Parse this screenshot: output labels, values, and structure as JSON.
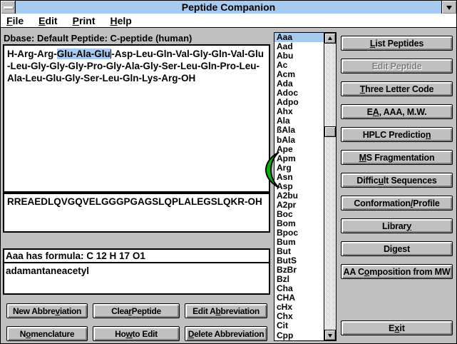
{
  "colors": {
    "title_bar_blue": "#A6CAF0",
    "window_gray": "#C0C0C0",
    "selection_highlight": "#A6CAF0",
    "marker_green": "#00B400"
  },
  "title_bar": {
    "title": "Peptide Companion"
  },
  "menu_bar": {
    "items": [
      {
        "label": "File",
        "u": 0
      },
      {
        "label": "Edit",
        "u": 0
      },
      {
        "label": "Print",
        "u": 0
      },
      {
        "label": "Help",
        "u": 0
      }
    ]
  },
  "status_line": {
    "text": "Dbase: Default  Peptide: C-peptide (human)"
  },
  "peptide_editor": {
    "pre_selection": "H-Arg-Arg-",
    "selection": "Glu-Ala-Glu",
    "post_selection": "-Asp-Leu-Gln-Val-Gly-Gln-Val-Glu-Leu-Gly-Gly-Gly-Pro-Gly-Ala-Gly-Ser-Leu-Gln-Pro-Leu-Ala-Leu-Glu-Gly-Ser-Leu-Gln-Lys-Arg-OH"
  },
  "one_letter_box": {
    "sequence": "RREAEDLQVGQVELGGGPGAGSLQPLALEGSLQKR-OH"
  },
  "abbreviation_info": {
    "formula_line": "Aaa  has formula:  C 12 H 17 O1",
    "full_name": "adamantaneacetyl"
  },
  "aa_list": {
    "selected_index": 0,
    "items": [
      "Aaa",
      "Aad",
      "Abu",
      "Ac",
      "Acm",
      "Ada",
      "Adoc",
      "Adpo",
      "Ahx",
      "Ala",
      "ßAla",
      "bAla",
      "Ape",
      "Apm",
      "Arg",
      "Asn",
      "Asp",
      "A2bu",
      "A2pr",
      "Boc",
      "Bom",
      "Bpoc",
      "Bum",
      "But",
      "ButS",
      "BzBr",
      "Bzl",
      "Cha",
      "CHA",
      "cHx",
      "Chx",
      "Cit",
      "Cpp"
    ]
  },
  "abbrev_buttons": {
    "new_abbreviation": {
      "label": "New Abbreviation",
      "u": 9
    },
    "clear_peptide": {
      "label": "Clear Peptide",
      "u": 4
    },
    "edit_abbreviation": {
      "label": "Edit Abbreviation",
      "u": 6
    },
    "nomenclature": {
      "label": "Nomenclature",
      "u": 1
    },
    "how_to_edit": {
      "label": "How to Edit",
      "u": 2
    },
    "delete_abbreviation": {
      "label": "Delete Abbreviation",
      "u": 0
    }
  },
  "action_buttons": {
    "list_peptides": {
      "label": "List Peptides",
      "u": 0
    },
    "edit_peptide": {
      "label": "Edit Peptide",
      "u": -1,
      "enabled": false
    },
    "three_letter_code": {
      "label": "Three Letter Code",
      "u": 0
    },
    "ea_aaa_mw": {
      "label": "EA, AAA, M.W.",
      "u": 1
    },
    "hplc_prediction": {
      "label": "HPLC Prediction",
      "u": 14
    },
    "ms_fragmentation": {
      "label": "MS Fragmentation",
      "u": 0
    },
    "difficult_sequences": {
      "label": "Difficult Sequences",
      "u": 6
    },
    "conformation_profile": {
      "label": "Conformation / Profile",
      "u": 13
    },
    "library": {
      "label": "Library",
      "u": 6
    },
    "digest": {
      "label": "Digest",
      "u": -1
    },
    "aa_composition_from_mw": {
      "label": "AA Composition from MW",
      "u": 4
    },
    "exit": {
      "label": "Exit",
      "u": 1
    }
  }
}
